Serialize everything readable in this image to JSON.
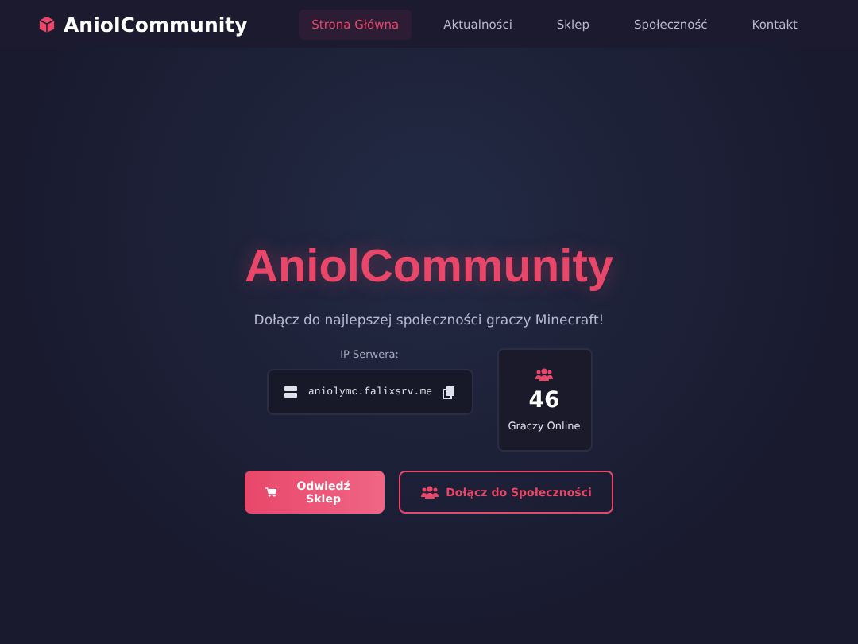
{
  "navbar": {
    "brand": "AniolCommunity",
    "links": [
      {
        "label": "Strona Główna",
        "selected": true
      },
      {
        "label": "Aktualności",
        "selected": false
      },
      {
        "label": "Sklep",
        "selected": false
      },
      {
        "label": "Społeczność",
        "selected": false
      },
      {
        "label": "Kontakt",
        "selected": false
      }
    ]
  },
  "hero": {
    "title": "AniolCommunity",
    "subtitle": "Dołącz do najlepszej społeczności graczy Minecraft!",
    "ip_label": "IP Serwera:",
    "ip": "aniolymc.falixsrv.me",
    "players_count": "46",
    "players_label": "Graczy Online",
    "buttons": [
      {
        "label": "Odwiedź Sklep",
        "kind": "primary"
      },
      {
        "label": "Dołącz do Społeczności",
        "kind": "outline"
      }
    ]
  }
}
